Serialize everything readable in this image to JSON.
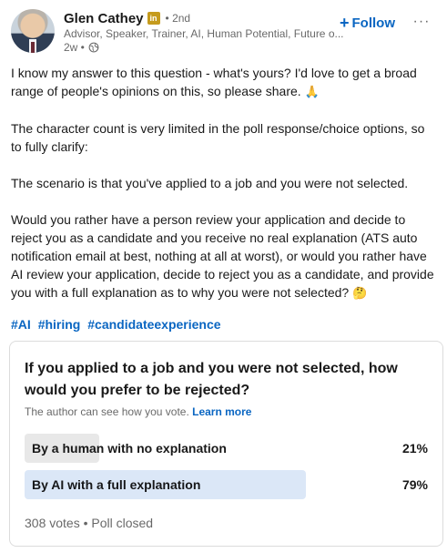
{
  "post": {
    "author": {
      "name": "Glen Cathey",
      "badge": "in",
      "degree": "• 2nd",
      "headline": "Advisor, Speaker, Trainer, AI, Human Potential, Future o...",
      "time": "2w •"
    },
    "follow_label": "Follow",
    "more_label": "···",
    "paragraphs": [
      "I know my answer to this question - what's yours? I'd love to get a broad range of people's opinions on this, so please share.",
      "The character count is very limited in the poll response/choice options, so to fully clarify:",
      "The scenario is that you've applied to a job and you were not selected.",
      "Would you rather have a person review your application and decide to reject you as a candidate and you receive no real explanation (ATS auto notification email at best, nothing at all at worst), or would you rather have AI review your application, decide to reject you as a candidate, and provide you with a full explanation as to why you were not selected?"
    ],
    "emoji_1": "🙏",
    "emoji_2": "🤔",
    "hashtags": [
      "#AI",
      "#hiring",
      "#candidateexperience"
    ]
  },
  "poll": {
    "question": "If you applied to a job and you were not selected, how would you prefer to be rejected?",
    "note": "The author can see how you vote.",
    "learn_more": "Learn more",
    "options": [
      {
        "label": "By a human with no explanation",
        "percent_label": "21%",
        "percent": 21,
        "fill_color": "#e8e8e8"
      },
      {
        "label": "By AI with a full explanation",
        "percent_label": "79%",
        "percent": 79,
        "fill_color": "#dbe7f7"
      }
    ],
    "footer": "308 votes • Poll closed"
  },
  "colors": {
    "link": "#0a66c2",
    "muted": "#666666",
    "badge": "#c59b1d"
  }
}
